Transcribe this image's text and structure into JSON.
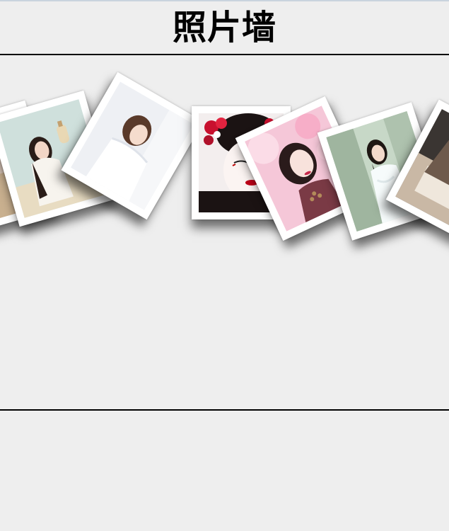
{
  "page": {
    "title": "照片墙"
  },
  "photos": [
    {
      "index": 0,
      "subject": "partial-photo-left-edge"
    },
    {
      "index": 1,
      "subject": "girl-sitting-holding-vase"
    },
    {
      "index": 2,
      "subject": "girl-white-dress-looking-up"
    },
    {
      "index": 3,
      "subject": "geisha-red-flowers"
    },
    {
      "index": 4,
      "subject": "woman-pink-blossoms"
    },
    {
      "index": 5,
      "subject": "woman-white-dress-forest"
    },
    {
      "index": 6,
      "subject": "person-writing-at-desk"
    }
  ],
  "colors": {
    "background": "#eeeeee",
    "frame": "#ffffff",
    "rule": "#000000"
  }
}
